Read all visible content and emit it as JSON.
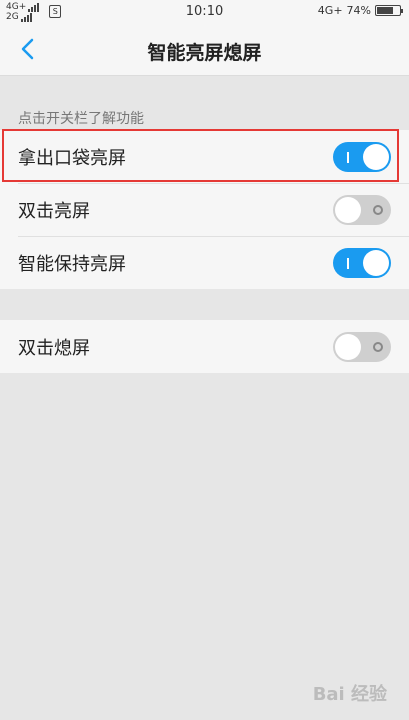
{
  "status_bar": {
    "net1": "4G+",
    "net2": "2G",
    "time": "10:10",
    "net_right": "4G+",
    "battery_percent": "74%",
    "battery_level": 0.74,
    "sim_icon": "sim-icon"
  },
  "nav": {
    "title": "智能亮屏熄屏",
    "back_icon": "chevron-left-icon"
  },
  "section": {
    "hint": "点击开关栏了解功能"
  },
  "group1": {
    "items": [
      {
        "label": "拿出口袋亮屏",
        "enabled": true
      },
      {
        "label": "双击亮屏",
        "enabled": false
      },
      {
        "label": "智能保持亮屏",
        "enabled": true
      }
    ]
  },
  "group2": {
    "items": [
      {
        "label": "双击熄屏",
        "enabled": false
      }
    ]
  },
  "watermark": {
    "text": "Bai 经验"
  },
  "colors": {
    "accent": "#1a9bf0",
    "highlight": "#e53935",
    "toggle_off": "#cfcfcf"
  }
}
